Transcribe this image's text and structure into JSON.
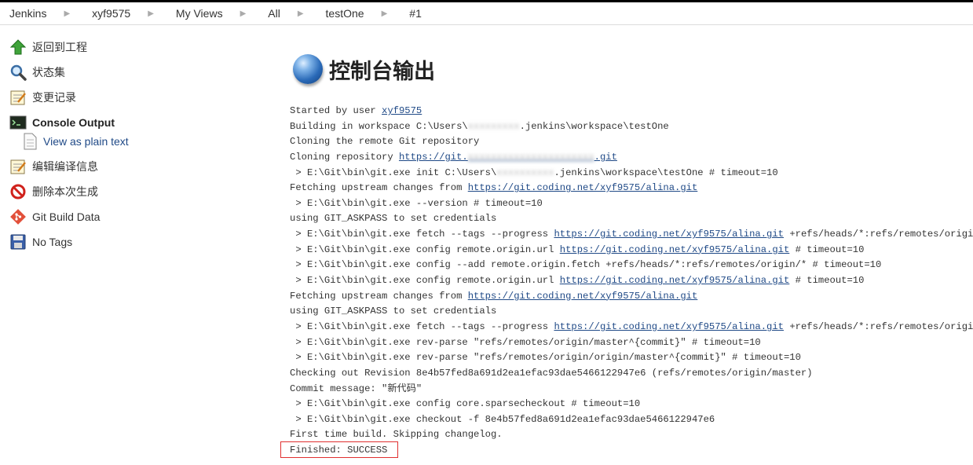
{
  "breadcrumb": [
    "Jenkins",
    "xyf9575",
    "My Views",
    "All",
    "testOne",
    "#1"
  ],
  "sidebar": {
    "items": [
      {
        "label": "返回到工程",
        "icon": "up-arrow-icon"
      },
      {
        "label": "状态集",
        "icon": "magnifier-icon"
      },
      {
        "label": "变更记录",
        "icon": "notepad-icon"
      },
      {
        "label": "Console Output",
        "icon": "terminal-icon"
      },
      {
        "label": "View as plain text",
        "icon": "document-icon"
      },
      {
        "label": "编辑编译信息",
        "icon": "notepad-pencil-icon"
      },
      {
        "label": "删除本次生成",
        "icon": "no-entry-icon"
      },
      {
        "label": "Git Build Data",
        "icon": "git-icon"
      },
      {
        "label": "No Tags",
        "icon": "save-icon"
      }
    ]
  },
  "main": {
    "title": "控制台输出"
  },
  "console": {
    "lines": [
      {
        "pre": "Started by user ",
        "link": "xyf9575",
        "post": ""
      },
      {
        "pre": "Building in workspace C:\\Users\\",
        "redacted": "xxxxxxxxx",
        "post": ".jenkins\\workspace\\testOne"
      },
      {
        "pre": "Cloning the remote Git repository"
      },
      {
        "pre": "Cloning repository ",
        "link": "https://git.",
        "redactedLink": "xxxxxxxxxxxxxxxxxxxxxx",
        "link2": ".git",
        "post": ""
      },
      {
        "pre": " > E:\\Git\\bin\\git.exe init C:\\Users\\",
        "redacted": "xxxxxxxxxx",
        "post": ".jenkins\\workspace\\testOne # timeout=10"
      },
      {
        "pre": "Fetching upstream changes from ",
        "link": "https://git.coding.net/xyf9575/alina.git",
        "post": ""
      },
      {
        "pre": " > E:\\Git\\bin\\git.exe --version # timeout=10"
      },
      {
        "pre": "using GIT_ASKPASS to set credentials"
      },
      {
        "pre": " > E:\\Git\\bin\\git.exe fetch --tags --progress ",
        "link": "https://git.coding.net/xyf9575/alina.git",
        "post": " +refs/heads/*:refs/remotes/origin/*"
      },
      {
        "pre": " > E:\\Git\\bin\\git.exe config remote.origin.url ",
        "link": "https://git.coding.net/xyf9575/alina.git",
        "post": " # timeout=10"
      },
      {
        "pre": " > E:\\Git\\bin\\git.exe config --add remote.origin.fetch +refs/heads/*:refs/remotes/origin/* # timeout=10"
      },
      {
        "pre": " > E:\\Git\\bin\\git.exe config remote.origin.url ",
        "link": "https://git.coding.net/xyf9575/alina.git",
        "post": " # timeout=10"
      },
      {
        "pre": "Fetching upstream changes from ",
        "link": "https://git.coding.net/xyf9575/alina.git",
        "post": ""
      },
      {
        "pre": "using GIT_ASKPASS to set credentials"
      },
      {
        "pre": " > E:\\Git\\bin\\git.exe fetch --tags --progress ",
        "link": "https://git.coding.net/xyf9575/alina.git",
        "post": " +refs/heads/*:refs/remotes/origin/*"
      },
      {
        "pre": " > E:\\Git\\bin\\git.exe rev-parse \"refs/remotes/origin/master^{commit}\" # timeout=10"
      },
      {
        "pre": " > E:\\Git\\bin\\git.exe rev-parse \"refs/remotes/origin/origin/master^{commit}\" # timeout=10"
      },
      {
        "pre": "Checking out Revision 8e4b57fed8a691d2ea1efac93dae5466122947e6 (refs/remotes/origin/master)"
      },
      {
        "pre": "Commit message: \"新代码\""
      },
      {
        "pre": " > E:\\Git\\bin\\git.exe config core.sparsecheckout # timeout=10"
      },
      {
        "pre": " > E:\\Git\\bin\\git.exe checkout -f 8e4b57fed8a691d2ea1efac93dae5466122947e6"
      },
      {
        "pre": "First time build. Skipping changelog."
      },
      {
        "pre": "Finished: SUCCESS"
      }
    ]
  },
  "colors": {
    "link": "#204a87",
    "highlight_border": "#e03030"
  }
}
